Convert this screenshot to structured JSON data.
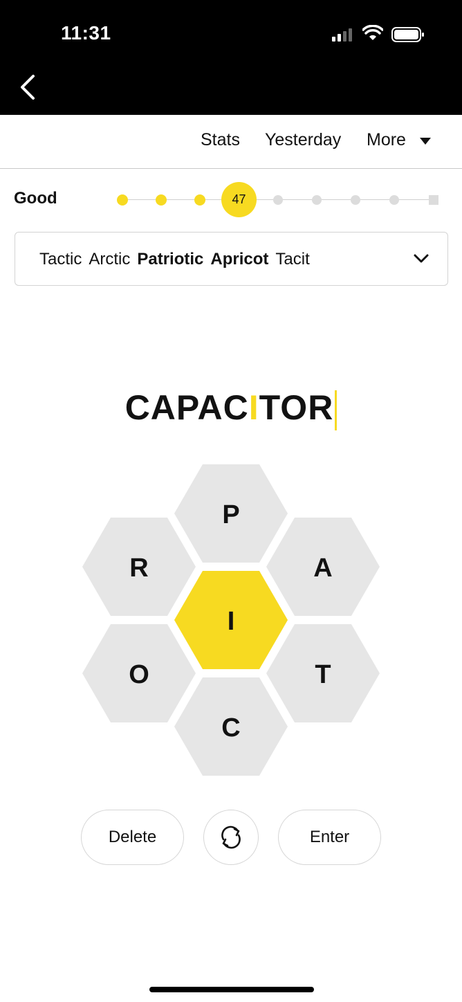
{
  "status_bar": {
    "time": "11:31"
  },
  "nav": {
    "back_icon": "chevron-left-icon"
  },
  "menu": {
    "stats": "Stats",
    "yesterday": "Yesterday",
    "more": "More"
  },
  "progress": {
    "rank": "Good",
    "score": "47",
    "filled_dots": 3,
    "total_steps": 9,
    "accent_color": "#f7da21"
  },
  "word_list": {
    "words": [
      {
        "text": "Tactic",
        "pangram": false
      },
      {
        "text": "Arctic",
        "pangram": false
      },
      {
        "text": "Patriotic",
        "pangram": true
      },
      {
        "text": "Apricot",
        "pangram": true
      },
      {
        "text": "Tacit",
        "pangram": false
      }
    ]
  },
  "entry": {
    "before": "CAPAC",
    "center": "I",
    "after": "TOR"
  },
  "hive": {
    "center": "I",
    "outer": [
      "P",
      "A",
      "T",
      "C",
      "O",
      "R"
    ]
  },
  "buttons": {
    "delete": "Delete",
    "enter": "Enter",
    "shuffle_icon": "shuffle-icon"
  }
}
